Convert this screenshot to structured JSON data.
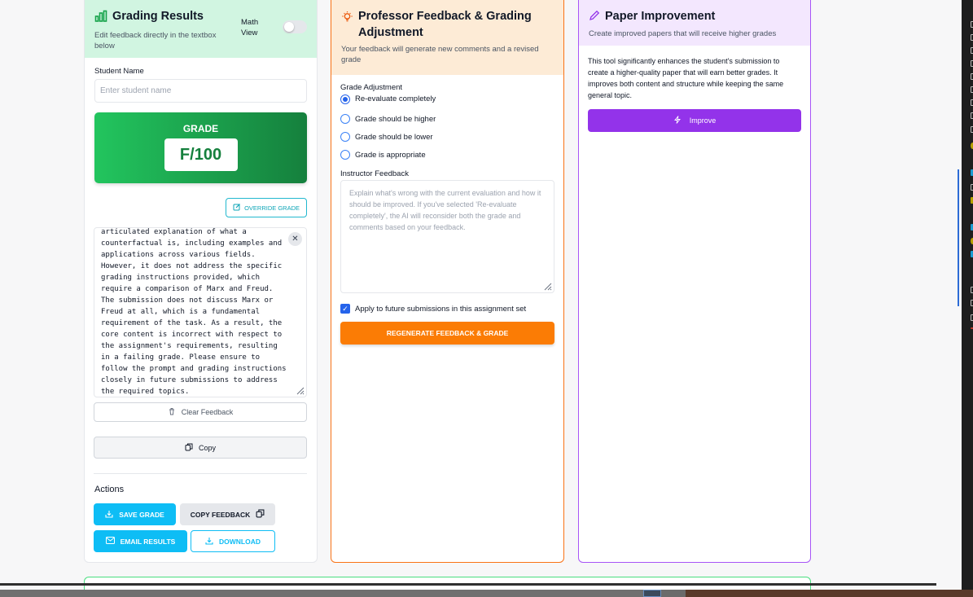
{
  "grading": {
    "title": "Grading Results",
    "subtitle": "Edit feedback directly in the textbox below",
    "math_view_label": "Math View",
    "student_name_label": "Student Name",
    "student_name_placeholder": "Enter student name",
    "grade_label": "GRADE",
    "grade_value": "F/100",
    "override_label": "OVERRIDE GRADE",
    "feedback_text": "articulated explanation of what a counterfactual is, including examples and applications across various fields. However, it does not address the specific grading instructions provided, which require a comparison of Marx and Freud. The submission does not discuss Marx or Freud at all, which is a fundamental requirement of the task. As a result, the core content is incorrect with respect to the assignment's requirements, resulting in a failing grade. Please ensure to follow the prompt and grading instructions closely in future submissions to address the required topics.",
    "clear_label": "Clear Feedback",
    "copy_label": "Copy",
    "actions_label": "Actions",
    "save_grade": "SAVE GRADE",
    "copy_feedback": "COPY FEEDBACK",
    "email_results": "EMAIL RESULTS",
    "download": "DOWNLOAD"
  },
  "professor": {
    "title": "Professor Feedback & Grading Adjustment",
    "subtitle": "Your feedback will generate new comments and a revised grade",
    "grade_adjustment_label": "Grade Adjustment",
    "options": [
      {
        "label": "Re-evaluate completely",
        "checked": true
      },
      {
        "label": "Grade should be higher",
        "checked": false
      },
      {
        "label": "Grade should be lower",
        "checked": false
      },
      {
        "label": "Grade is appropriate",
        "checked": false
      }
    ],
    "instructor_feedback_label": "Instructor Feedback",
    "instructor_feedback_placeholder": "Explain what's wrong with the current evaluation and how it should be improved. If you've selected 'Re-evaluate completely', the AI will reconsider both the grade and comments based on your feedback.",
    "apply_future_label": "Apply to future submissions in this assignment set",
    "regenerate_label": "REGENERATE FEEDBACK & GRADE"
  },
  "improvement": {
    "title": "Paper Improvement",
    "subtitle": "Create improved papers that will receive higher grades",
    "description": "This tool significantly enhances the student's submission to create a higher-quality paper that will earn better grades. It improves both content and structure while keeping the same general topic.",
    "improve_label": "Improve"
  },
  "colors": {
    "grading_header": "#d1f5e1",
    "professor_header": "#fdebd6",
    "improvement_header": "#f3e7fe",
    "accent_cyan": "#0ebdf5",
    "accent_orange": "#fb7c05",
    "accent_purple": "#9333ea"
  }
}
